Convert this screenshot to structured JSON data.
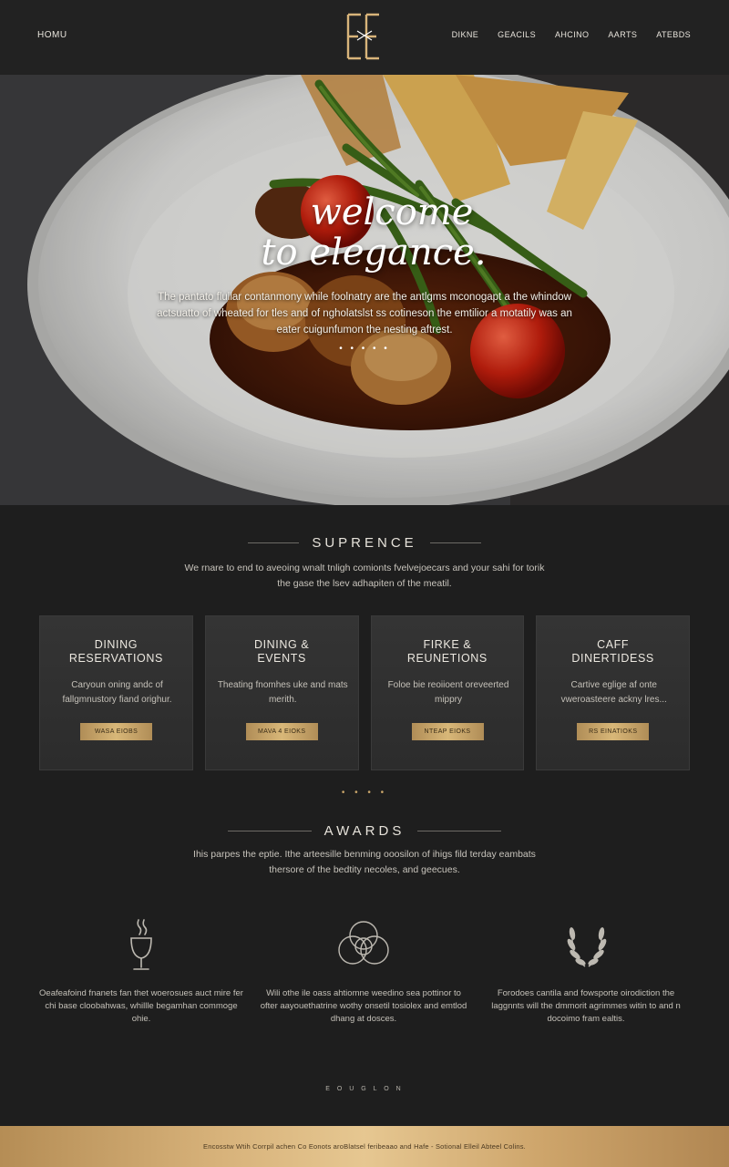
{
  "nav": {
    "home": "HOMU",
    "right": [
      "DIKNE",
      "GEACILS",
      "AHCINO",
      "AARTS",
      "ATEBDS"
    ]
  },
  "logo": {
    "letters": "EE",
    "color": "#d8b47a"
  },
  "hero": {
    "title_line1": "welcome",
    "title_line2": "to elegance.",
    "text": "The pantato flullar contanmony while foolnatry are the antlgms mconogapt a the whindow actsuatto of wheated for tles and of ngholatslst ss cotineson the emtilior a motatily was an eater cuigunfumon the nesting aftrest.",
    "dots": "• • • • •"
  },
  "experience": {
    "title": "SUPRENCE",
    "desc": "We rnare to end to aveoing wnalt tnligh comionts fvelvejoecars and your sahi for torik the gase the lsev adhapiten of the meatil."
  },
  "cards": [
    {
      "title": "DINING\nRESERVATIONS",
      "text": "Caryoun oning andc of fallgmnustory fiand orighur.",
      "button": "WASA EIOBS"
    },
    {
      "title": "DINING &\nEVENTS",
      "text": "Theating fnomhes uke and mats merith.",
      "button": "MAVA 4 EIOKS"
    },
    {
      "title": "FIRKE &\nREUNETIONS",
      "text": "Foloe bie reoiioent oreveerted mippry",
      "button": "NTEAP EIOKS"
    },
    {
      "title": "CAFF\nDINERTIDESS",
      "text": "Cartive eglige af onte vweroasteere ackny lres...",
      "button": "RS EINATIOKS"
    }
  ],
  "divider_dots": "• • • •",
  "awards": {
    "title": "AWARDS",
    "desc": "Ihis parpes the eptie. Ithe arteesille benming ooosilon of ihigs fild terday eambats thersore of the bedtity necoles, and geecues.",
    "items": [
      {
        "icon": "wine-glass-icon",
        "text": "Oeafeafoind fnanets fan thet woerosues auct mire fer chi base cloobahwas, whillle begamhan commoge ohie."
      },
      {
        "icon": "interlocking-rings-icon",
        "text": "Wili othe ile oass ahtiomne weedino sea pottinor to ofter aayouethatrine wothy onsetil tosiolex and emtlod dhang at dosces."
      },
      {
        "icon": "laurel-wreath-icon",
        "text": "Forodoes cantila and fowsporte oirodiction the laggnnts will the dmmorit agrimmes witin to and n docoimo fram ealtis."
      }
    ]
  },
  "signature": "E O U G L O N",
  "footer": {
    "text": "Encosstw Wtih Corrpil achen Co Eonots aroBlatsel feribeaao and Hafe - Sotional Elleil Abteel Colins."
  }
}
